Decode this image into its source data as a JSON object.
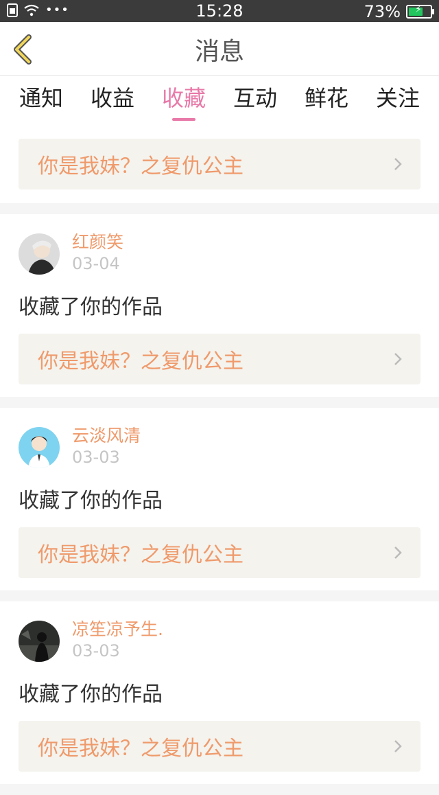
{
  "statusbar": {
    "time": "15:28",
    "battery": "73%",
    "battery_level": 0.73
  },
  "header": {
    "title": "消息"
  },
  "tabs": [
    {
      "label": "通知",
      "active": false
    },
    {
      "label": "收益",
      "active": false
    },
    {
      "label": "收藏",
      "active": true
    },
    {
      "label": "互动",
      "active": false
    },
    {
      "label": "鲜花",
      "active": false
    },
    {
      "label": "关注",
      "active": false
    }
  ],
  "top_link": {
    "title": "你是我妹？之复仇公主"
  },
  "items": [
    {
      "username": "红颜笑",
      "date": "03-04",
      "action": "收藏了你的作品",
      "work": "你是我妹？之复仇公主"
    },
    {
      "username": "云淡风清",
      "date": "03-03",
      "action": "收藏了你的作品",
      "work": "你是我妹？之复仇公主"
    },
    {
      "username": "凉笙凉予生.",
      "date": "03-03",
      "action": "收藏了你的作品",
      "work": "你是我妹？之复仇公主"
    }
  ],
  "colors": {
    "accent": "#e879a8",
    "link": "#ef9a6b",
    "link_bg": "#f4f3ee"
  }
}
